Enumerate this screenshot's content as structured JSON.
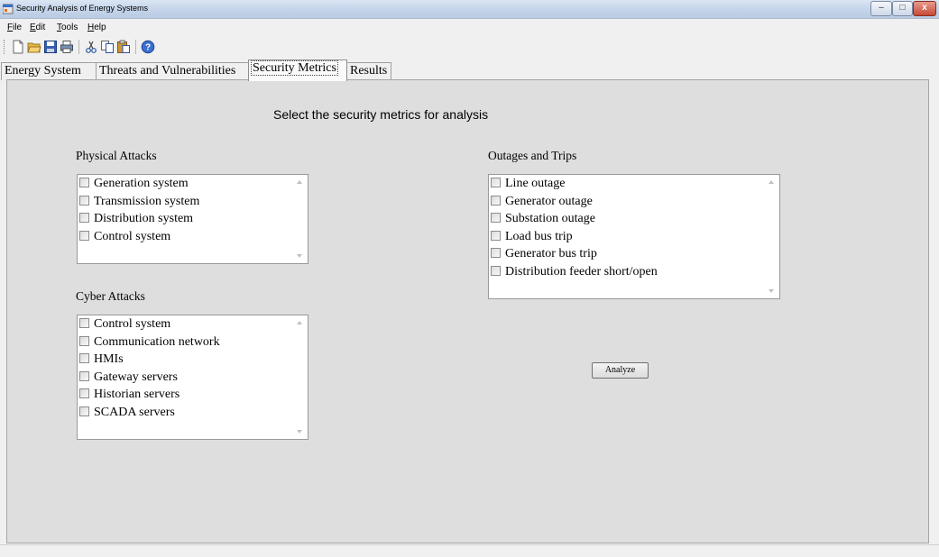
{
  "window": {
    "title": "Security Analysis of Energy Systems",
    "controls": {
      "minimize": "–",
      "maximize": "□",
      "close": "x"
    }
  },
  "menu": {
    "file": {
      "mnemonic": "F",
      "rest": "ile"
    },
    "edit": {
      "mnemonic": "E",
      "rest": "dit"
    },
    "tools": {
      "mnemonic": "T",
      "rest": "ools"
    },
    "help": {
      "mnemonic": "H",
      "rest": "elp"
    }
  },
  "toolbar": {
    "icons": [
      "new-file-icon",
      "open-folder-icon",
      "save-icon",
      "print-icon",
      "cut-icon",
      "copy-icon",
      "paste-icon",
      "help-icon"
    ]
  },
  "tabs": [
    {
      "label": "Energy System",
      "active": false
    },
    {
      "label": "Threats and Vulnerabilities",
      "active": false
    },
    {
      "label": "Security Metrics",
      "active": true
    },
    {
      "label": "Results",
      "active": false
    }
  ],
  "page": {
    "heading": "Select the security metrics for analysis",
    "physical": {
      "label": "Physical Attacks",
      "items": [
        "Generation system",
        "Transmission system",
        "Distribution system",
        "Control system"
      ]
    },
    "cyber": {
      "label": "Cyber Attacks",
      "items": [
        "Control system",
        "Communication network",
        "HMIs",
        "Gateway servers",
        "Historian servers",
        "SCADA servers"
      ]
    },
    "outages": {
      "label": "Outages and Trips",
      "items": [
        "Line outage",
        "Generator outage",
        "Substation outage",
        "Load bus trip",
        "Generator bus trip",
        "Distribution feeder short/open"
      ]
    },
    "analyze_label": "Analyze"
  },
  "colors": {
    "panel_bg": "#dedede",
    "window_bg": "#f0f0f0",
    "titlebar": "#c7d6ea",
    "close_button": "#c74a36"
  }
}
